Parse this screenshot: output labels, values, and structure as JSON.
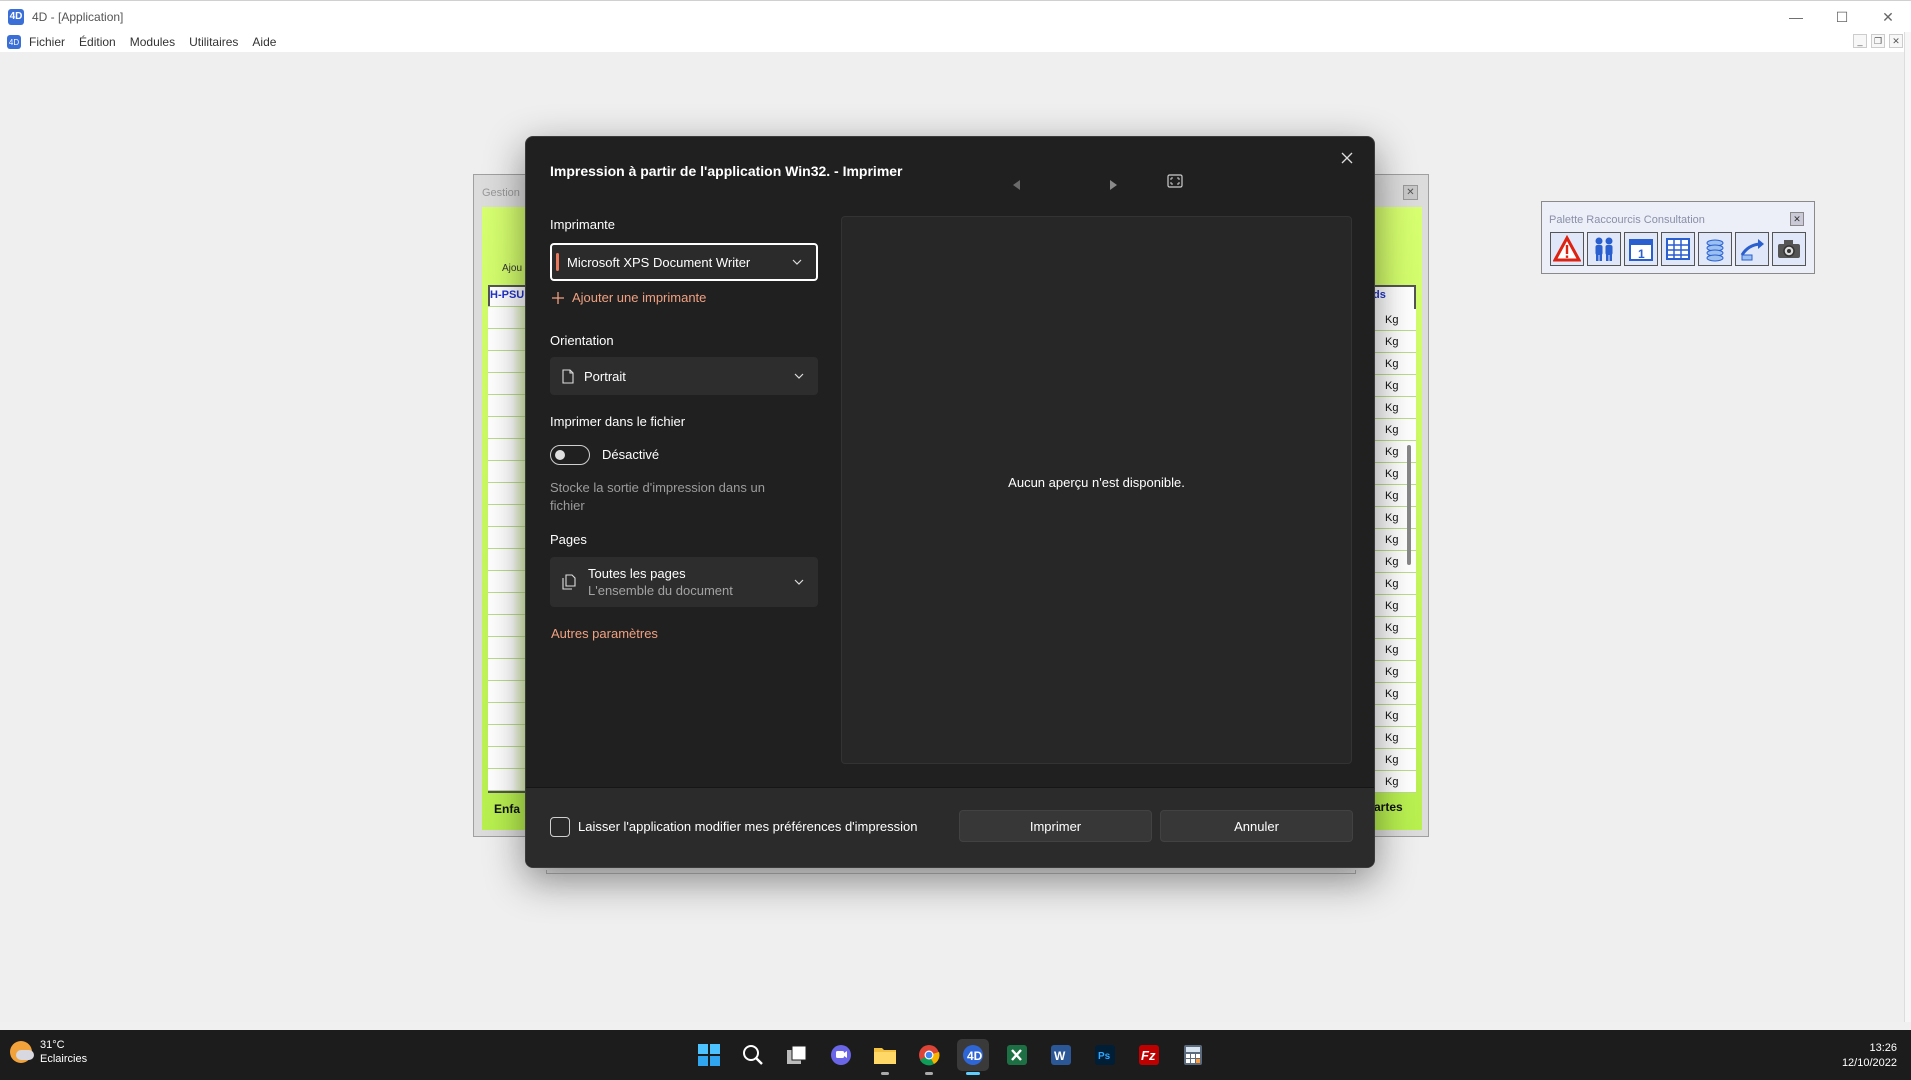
{
  "window": {
    "title": "4D - [Application]",
    "app_icon": "4D"
  },
  "menu": {
    "items": [
      "Fichier",
      "Édition",
      "Modules",
      "Utilitaires",
      "Aide"
    ]
  },
  "background_window": {
    "title": "Gestion",
    "left_header": "H-PSU",
    "right_header": "ds",
    "unit": "Kg",
    "footer_left": "Enfa",
    "footer_right": "artes",
    "toolbar_label": "Ajou"
  },
  "palette": {
    "title": "Palette Raccourcis Consultation",
    "tools": [
      "warning-icon",
      "people-icon",
      "calendar-icon",
      "table-icon",
      "coins-icon",
      "transfer-icon",
      "camera-icon"
    ]
  },
  "dialog": {
    "title": "Impression à partir de l'application Win32. - Imprimer",
    "printer_label": "Imprimante",
    "printer_value": "Microsoft XPS Document Writer",
    "add_printer": "Ajouter une imprimante",
    "orientation_label": "Orientation",
    "orientation_value": "Portrait",
    "print_to_file_label": "Imprimer dans le fichier",
    "print_to_file_state": "Désactivé",
    "print_to_file_hint": "Stocke la sortie d'impression dans un fichier",
    "pages_label": "Pages",
    "pages_value": "Toutes les pages",
    "pages_sub": "L'ensemble du document",
    "more_settings": "Autres paramètres",
    "preview_message": "Aucun aperçu n'est disponible.",
    "allow_prefs_label": "Laisser l'application modifier mes préférences d'impression",
    "print_button": "Imprimer",
    "cancel_button": "Annuler"
  },
  "taskbar": {
    "weather_temp": "31°C",
    "weather_desc": "Eclaircies",
    "time": "13:26",
    "date": "12/10/2022"
  },
  "colors": {
    "accent": "#f0a080",
    "dialog_bg": "#202020",
    "taskbar_bg": "#1c1c1c"
  }
}
